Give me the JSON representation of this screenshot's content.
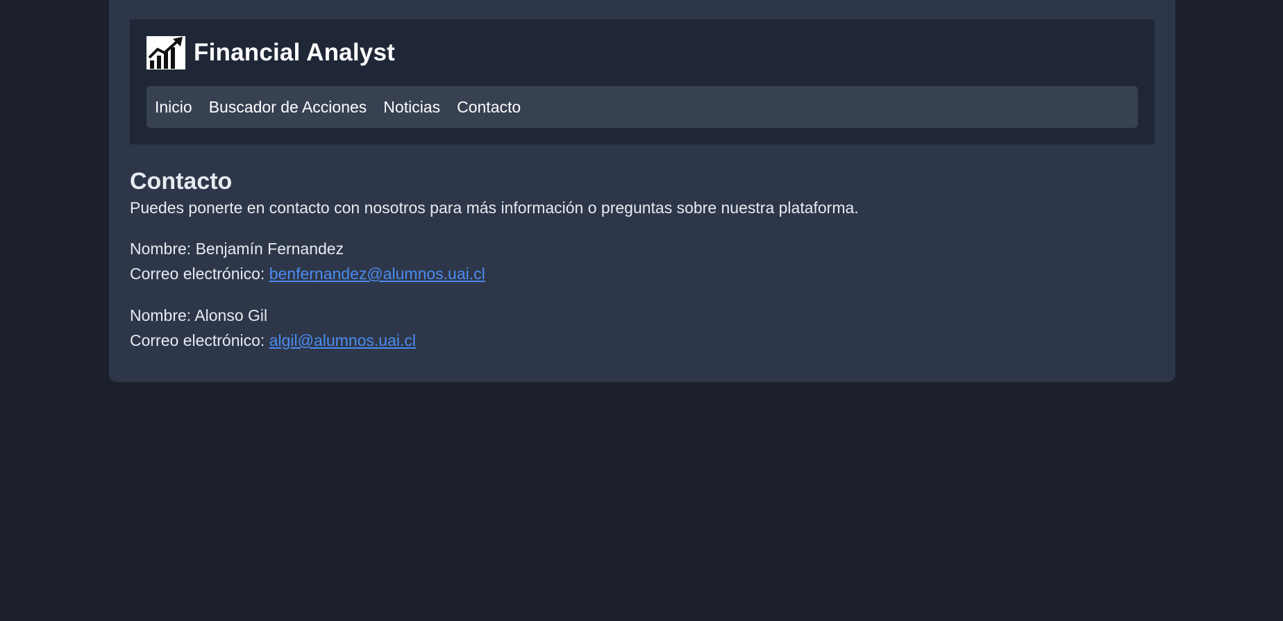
{
  "brand": {
    "title": "Financial Analyst",
    "logo_icon": "chart-trending-up-icon"
  },
  "nav": {
    "items": [
      {
        "label": "Inicio"
      },
      {
        "label": "Buscador de Acciones"
      },
      {
        "label": "Noticias"
      },
      {
        "label": "Contacto"
      }
    ]
  },
  "content": {
    "title": "Contacto",
    "intro": "Puedes ponerte en contacto con nosotros para más información o preguntas sobre nuestra plataforma.",
    "contacts": [
      {
        "name_label": "Nombre: Benjamín Fernandez",
        "email_label": "Correo electrónico: ",
        "email": "benfernandez@alumnos.uai.cl"
      },
      {
        "name_label": "Nombre: Alonso Gil",
        "email_label": "Correo electrónico: ",
        "email": "algil@alumnos.uai.cl"
      }
    ]
  },
  "colors": {
    "page_background": "#1b202b",
    "card_background": "#2e3749",
    "header_background": "#1f2737",
    "nav_background": "#384152",
    "link": "#4a8cf0"
  }
}
